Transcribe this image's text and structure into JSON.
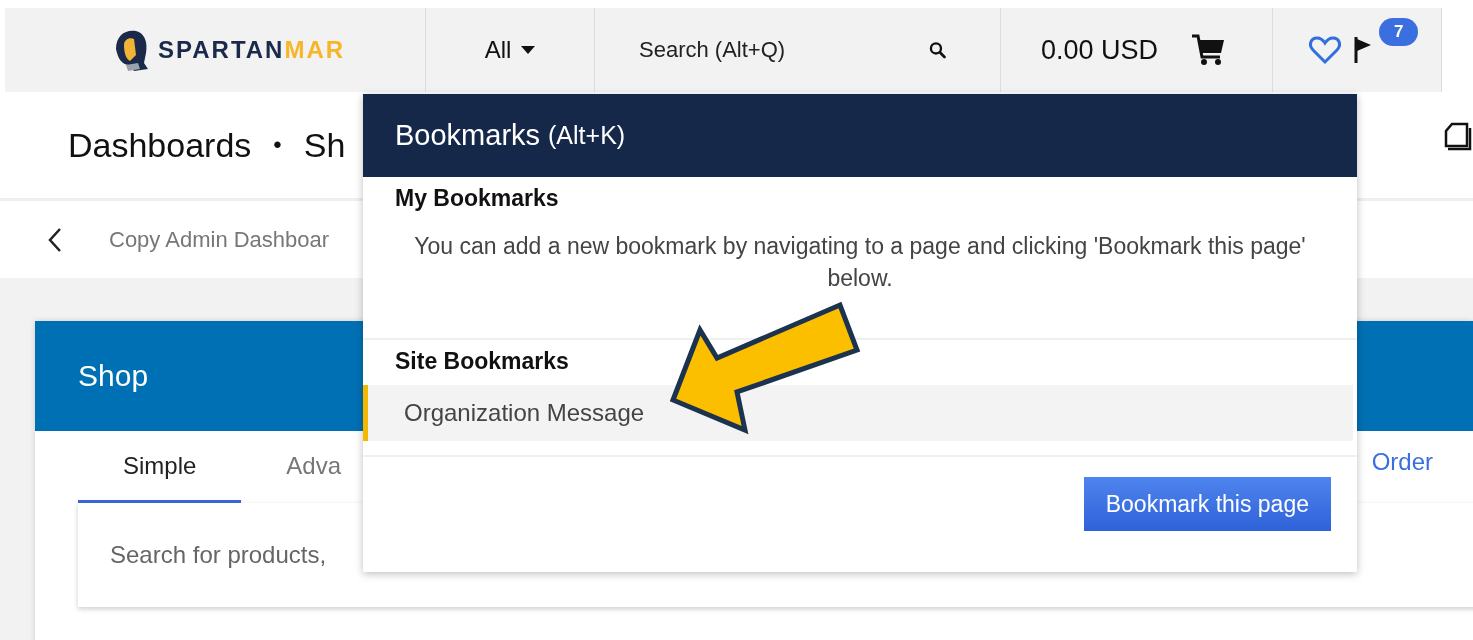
{
  "header": {
    "logo": {
      "brand": "SPARTAN",
      "brand_accent": "MAR"
    },
    "scope_dropdown": "All",
    "search": {
      "placeholder": "Search (Alt+Q)"
    },
    "cart_total": "0.00 USD",
    "notifications_badge": "7"
  },
  "title_bar": {
    "section": "Dashboards",
    "separator": "•",
    "page": "Sh"
  },
  "breadcrumb": {
    "label": "Copy Admin Dashboar"
  },
  "card": {
    "title": "Shop",
    "tabs": [
      {
        "label": "Simple",
        "selected": true
      },
      {
        "label": "Adva",
        "selected": false
      },
      {
        "label": "Order",
        "selected": false
      }
    ],
    "search": {
      "placeholder": "Search for products,"
    }
  },
  "bookmarks_popup": {
    "title": "Bookmarks",
    "shortcut": "(Alt+K)",
    "sections": [
      {
        "heading": "My Bookmarks",
        "message": "You can add a new bookmark by navigating to a page and clicking 'Bookmark this page' below."
      },
      {
        "heading": "Site Bookmarks",
        "items": [
          {
            "label": "Organization Message",
            "highlighted": true
          }
        ]
      }
    ],
    "button": "Bookmark this page"
  }
}
